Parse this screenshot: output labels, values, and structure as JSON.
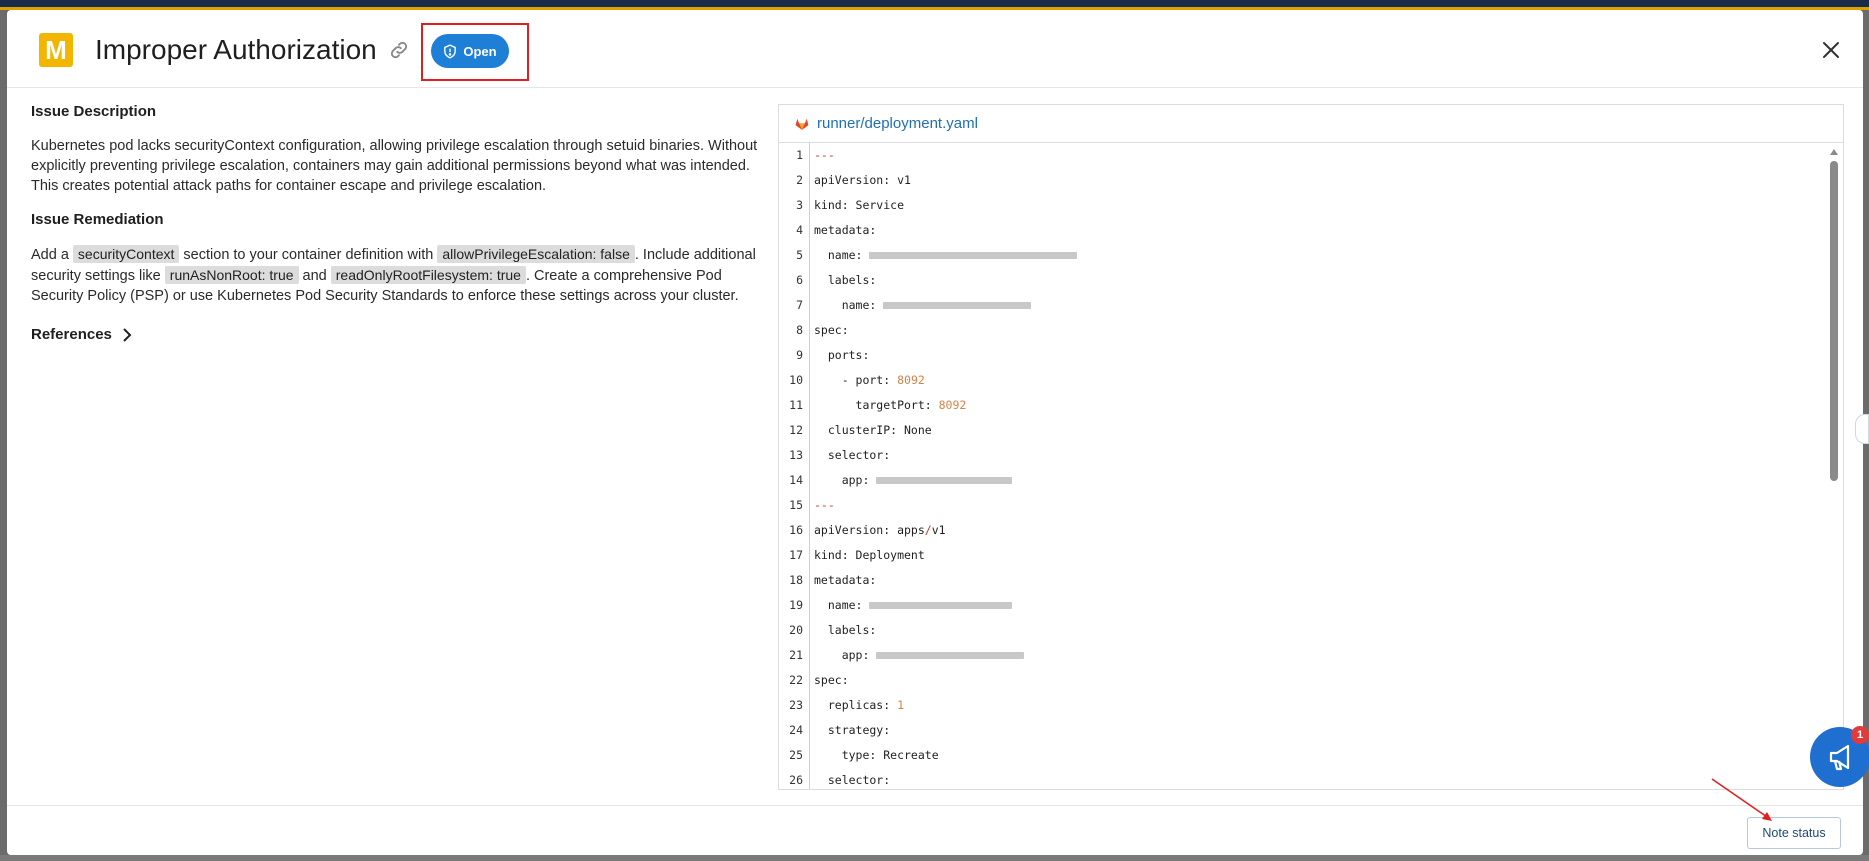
{
  "modal": {
    "severity_letter": "M",
    "title": "Improper Authorization",
    "status_label": "Open",
    "colors": {
      "severity": "#f2b500",
      "status": "#1e7fd6",
      "link": "#1f6fb4"
    }
  },
  "description": {
    "heading": "Issue Description",
    "text": "Kubernetes pod lacks securityContext configuration, allowing privilege escalation through setuid binaries. Without explicitly preventing privilege escalation, containers may gain additional permissions beyond what was intended. This creates potential attack paths for container escape and privilege escalation."
  },
  "remediation": {
    "heading": "Issue Remediation",
    "t1": "Add a ",
    "c1": "securityContext",
    "t2": " section to your container definition with ",
    "c2": "allowPrivilegeEscalation: false",
    "t3": ". Include additional security settings like ",
    "c3": "runAsNonRoot: true",
    "t4": " and ",
    "c4": "readOnlyRootFilesystem: true",
    "t5": ". Create a comprehensive Pod Security Policy (PSP) or use Kubernetes Pod Security Standards to enforce these settings across your cluster."
  },
  "references_label": "References",
  "code": {
    "file_name": "runner/deployment.yaml",
    "lines": [
      {
        "n": "1",
        "a": "---"
      },
      {
        "n": "2",
        "a": "apiVersion: v1"
      },
      {
        "n": "3",
        "a": "kind: Service"
      },
      {
        "n": "4",
        "a": "metadata:"
      },
      {
        "n": "5",
        "a": "  name: "
      },
      {
        "n": "6",
        "a": "  labels:"
      },
      {
        "n": "7",
        "a": "    name: "
      },
      {
        "n": "8",
        "a": "spec:"
      },
      {
        "n": "9",
        "a": "  ports:"
      },
      {
        "n": "10",
        "a": "    - port: ",
        "num": "8092"
      },
      {
        "n": "11",
        "a": "      targetPort: ",
        "num": "8092"
      },
      {
        "n": "12",
        "a": "  clusterIP: None"
      },
      {
        "n": "13",
        "a": "  selector:"
      },
      {
        "n": "14",
        "a": "    app: "
      },
      {
        "n": "15",
        "a": "---"
      },
      {
        "n": "16",
        "a": "apiVersion: apps/v1"
      },
      {
        "n": "17",
        "a": "kind: Deployment"
      },
      {
        "n": "18",
        "a": "metadata:"
      },
      {
        "n": "19",
        "a": "  name: "
      },
      {
        "n": "20",
        "a": "  labels:"
      },
      {
        "n": "21",
        "a": "    app: "
      },
      {
        "n": "22",
        "a": "spec:"
      },
      {
        "n": "23",
        "a": "  replicas: ",
        "num": "1"
      },
      {
        "n": "24",
        "a": "  strategy:"
      },
      {
        "n": "25",
        "a": "    type: Recreate"
      },
      {
        "n": "26",
        "a": "  selector:"
      }
    ]
  },
  "footer": {
    "note_status_label": "Note status"
  },
  "notifications": {
    "count": "1"
  }
}
